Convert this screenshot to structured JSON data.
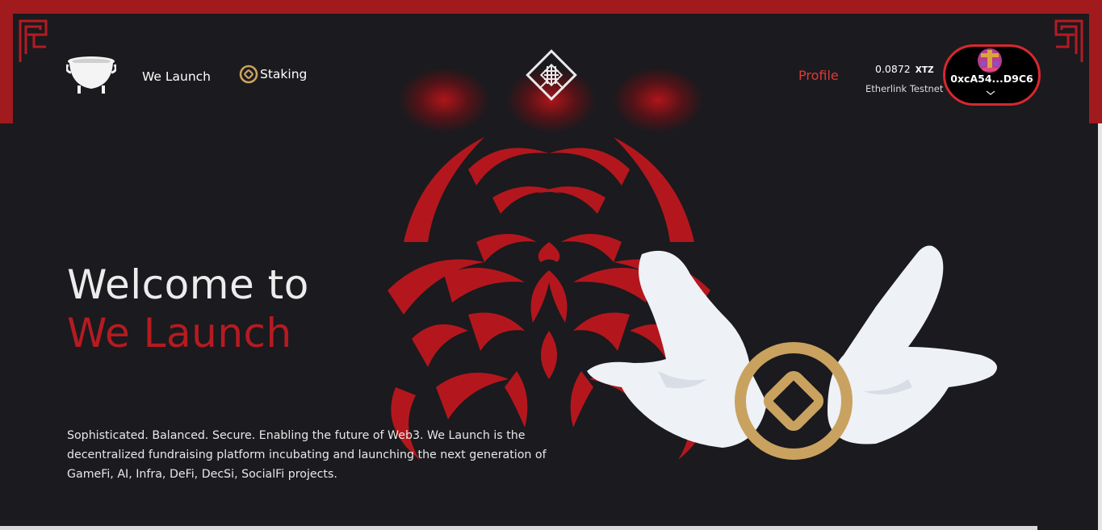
{
  "header": {
    "nav": {
      "we_launch": "We Launch",
      "staking": "Staking",
      "profile": "Profile"
    },
    "wallet": {
      "balance": "0.0872",
      "unit": "XTZ",
      "network": "Etherlink Testnet",
      "address": "0xcA54...D9C6"
    }
  },
  "hero": {
    "title_line1": "Welcome to",
    "title_line2": "We Launch",
    "description": "Sophisticated. Balanced. Secure. Enabling the future of Web3. We Launch is the decentralized fundraising platform incubating and launching the next generation of GameFi, AI, Infra, DeFi, DecSi, SocialFi projects."
  },
  "icons": [
    "cauldron-logo-icon",
    "staking-coin-icon",
    "diamond-knot-logo-icon",
    "avatar-icon",
    "chevron-down-icon",
    "red-flower-ornament",
    "hands-coin-illustration",
    "corner-pattern-icon"
  ],
  "colors": {
    "background": "#1b1a1e",
    "brand_red": "#b51b21",
    "frame_red": "#a01a1e",
    "profile_red": "#e03a3a",
    "gold": "#c9a260"
  }
}
